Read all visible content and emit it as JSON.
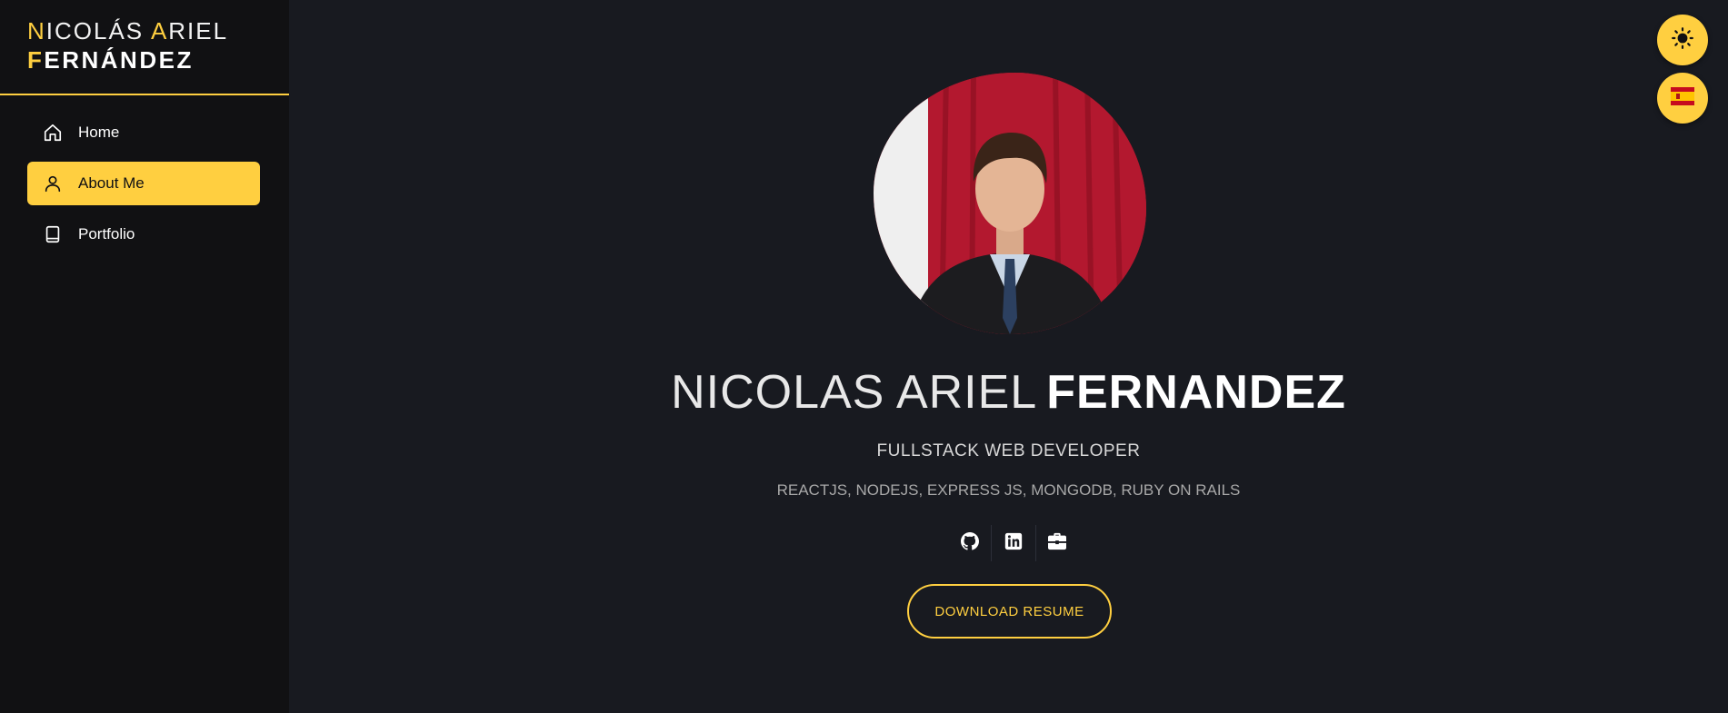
{
  "brand": {
    "first_initial": "N",
    "first_rest": "ICOLÁS ",
    "middle_initial": "A",
    "middle_rest": "RIEL",
    "last_initial": "F",
    "last_rest": "ERNÁNDEZ"
  },
  "nav": {
    "items": [
      {
        "label": "Home",
        "icon": "home-icon",
        "active": false
      },
      {
        "label": "About Me",
        "icon": "user-icon",
        "active": true
      },
      {
        "label": "Portfolio",
        "icon": "book-icon",
        "active": false
      }
    ]
  },
  "controls": {
    "theme_icon": "sun-icon",
    "language_icon": "spain-flag-icon"
  },
  "hero": {
    "name_first": "NICOLAS ARIEL",
    "name_last": "FERNANDEZ",
    "role": "FULLSTACK WEB DEVELOPER",
    "skills": "REACTJS, NODEJS, EXPRESS JS, MONGODB, RUBY ON RAILS",
    "socials": [
      {
        "icon": "github-icon"
      },
      {
        "icon": "linkedin-icon"
      },
      {
        "icon": "briefcase-icon"
      }
    ],
    "download_label": "DOWNLOAD RESUME"
  },
  "colors": {
    "accent": "#ffcf40",
    "background": "#181a20",
    "sidebar": "#111113"
  }
}
